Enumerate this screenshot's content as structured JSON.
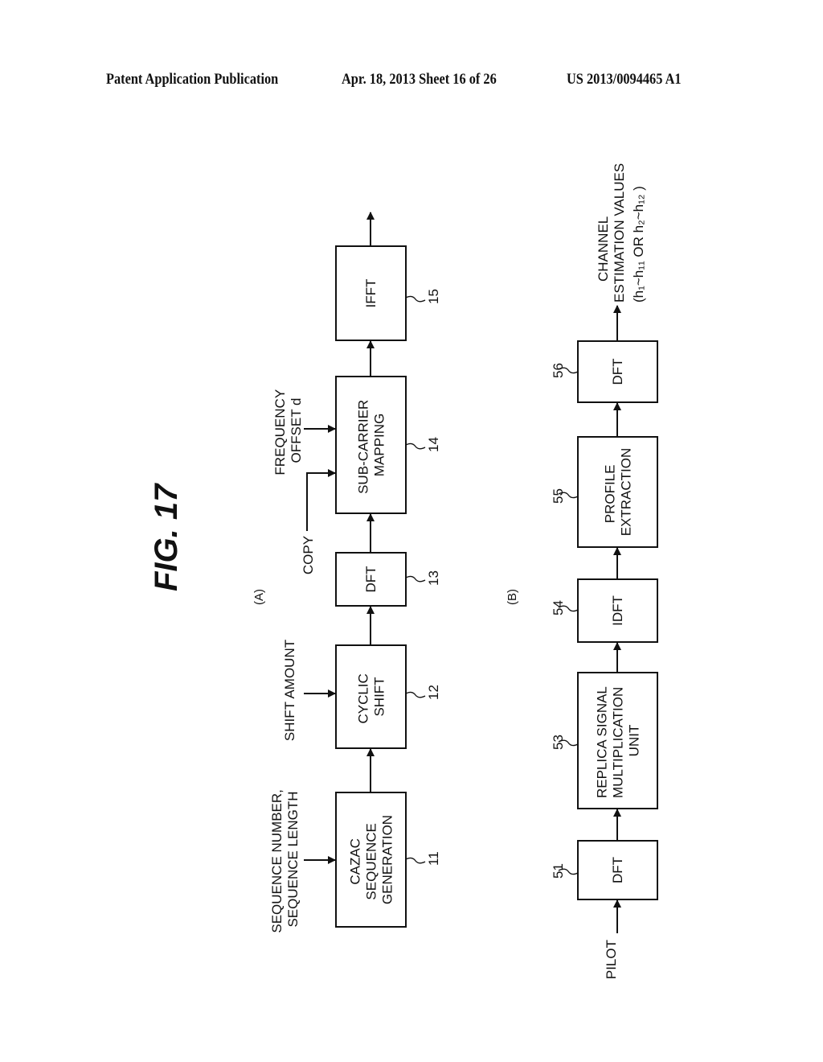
{
  "header": {
    "left": "Patent Application Publication",
    "middle": "Apr. 18, 2013  Sheet 16 of 26",
    "right": "US 2013/0094465 A1"
  },
  "figure": {
    "title": "FIG. 17",
    "part_a": {
      "label": "(A)",
      "inputs": {
        "sequence_line1": "SEQUENCE NUMBER,",
        "sequence_line2": "SEQUENCE LENGTH",
        "shift": "SHIFT AMOUNT",
        "copy": "COPY",
        "freq_line1": "FREQUENCY",
        "freq_line2": "OFFSET d"
      },
      "blocks": [
        {
          "ref": "11",
          "lines": [
            "CAZAC",
            "SEQUENCE",
            "GENERATION"
          ]
        },
        {
          "ref": "12",
          "lines": [
            "CYCLIC",
            "SHIFT"
          ]
        },
        {
          "ref": "13",
          "lines": [
            "DFT"
          ]
        },
        {
          "ref": "14",
          "lines": [
            "SUB-CARRIER",
            "MAPPING"
          ]
        },
        {
          "ref": "15",
          "lines": [
            "IFFT"
          ]
        }
      ]
    },
    "part_b": {
      "label": "(B)",
      "input": "PILOT",
      "output_line1": "CHANNEL",
      "output_line2": "ESTIMATION VALUES",
      "output_line3": "(h₁~h₁₁ OR  h₂~h₁₂ )",
      "blocks": [
        {
          "ref": "51",
          "lines": [
            "DFT"
          ]
        },
        {
          "ref": "53",
          "lines": [
            "REPLICA SIGNAL",
            "MULTIPLICATION",
            "UNIT"
          ]
        },
        {
          "ref": "54",
          "lines": [
            "IDFT"
          ]
        },
        {
          "ref": "55",
          "lines": [
            "PROFILE",
            "EXTRACTION"
          ]
        },
        {
          "ref": "56",
          "lines": [
            "DFT"
          ]
        }
      ]
    }
  }
}
